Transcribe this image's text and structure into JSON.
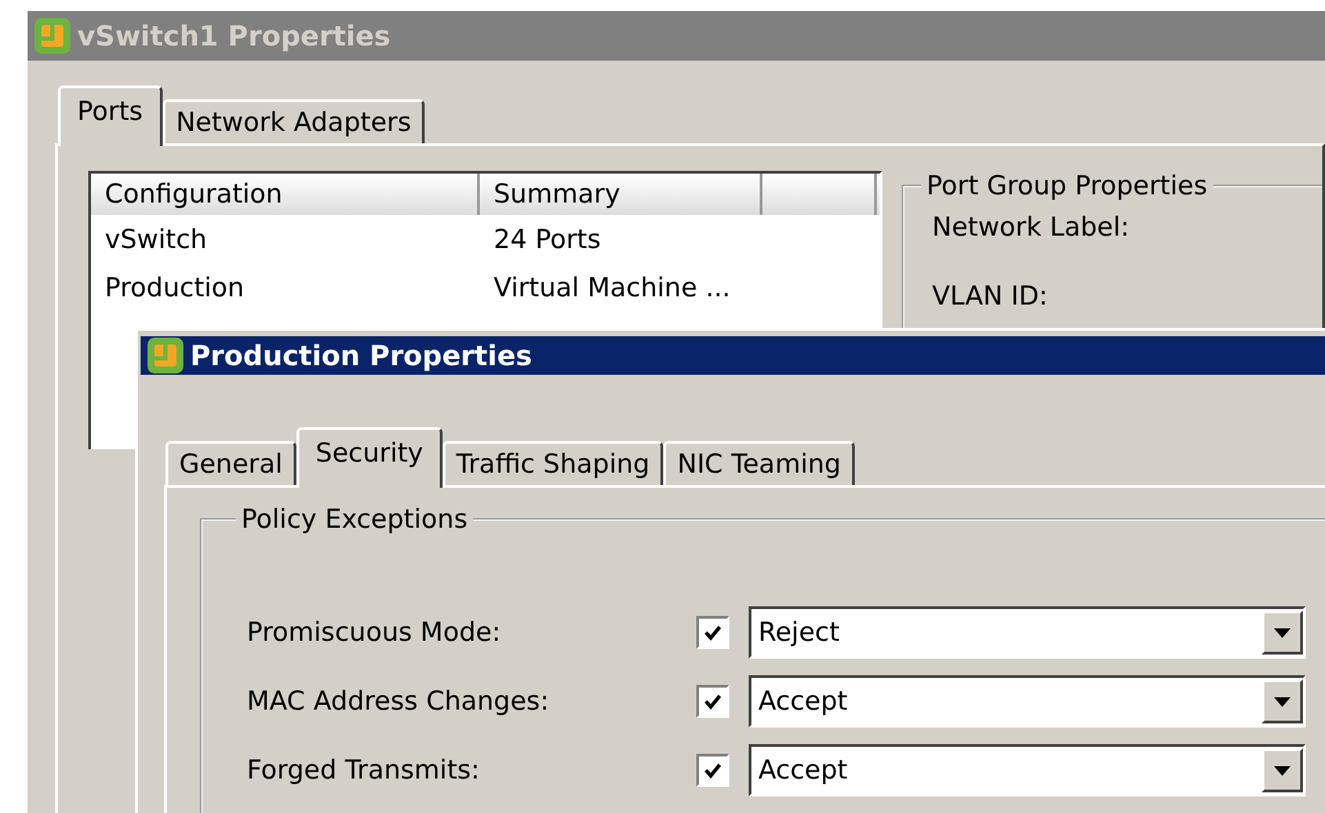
{
  "outer_window": {
    "title": "vSwitch1 Properties",
    "active": false,
    "tabs": [
      {
        "label": "Ports",
        "selected": true
      },
      {
        "label": "Network Adapters",
        "selected": false
      }
    ],
    "table": {
      "columns": [
        "Configuration",
        "Summary"
      ],
      "rows": [
        {
          "cells": [
            "vSwitch",
            "24 Ports"
          ]
        },
        {
          "cells": [
            "Production",
            "Virtual Machine ..."
          ]
        }
      ]
    },
    "port_group_properties": {
      "title": "Port Group Properties",
      "fields": [
        "Network Label:",
        "VLAN ID:"
      ]
    }
  },
  "dialog": {
    "title": "Production Properties",
    "active": true,
    "tabs": [
      {
        "label": "General",
        "selected": false
      },
      {
        "label": "Security",
        "selected": true
      },
      {
        "label": "Traffic Shaping",
        "selected": false
      },
      {
        "label": "NIC Teaming",
        "selected": false
      }
    ],
    "policy_exceptions": {
      "title": "Policy Exceptions",
      "rows": [
        {
          "label": "Promiscuous Mode:",
          "checked": true,
          "value": "Reject"
        },
        {
          "label": "MAC Address Changes:",
          "checked": true,
          "value": "Accept"
        },
        {
          "label": "Forged Transmits:",
          "checked": true,
          "value": "Accept"
        }
      ]
    }
  }
}
